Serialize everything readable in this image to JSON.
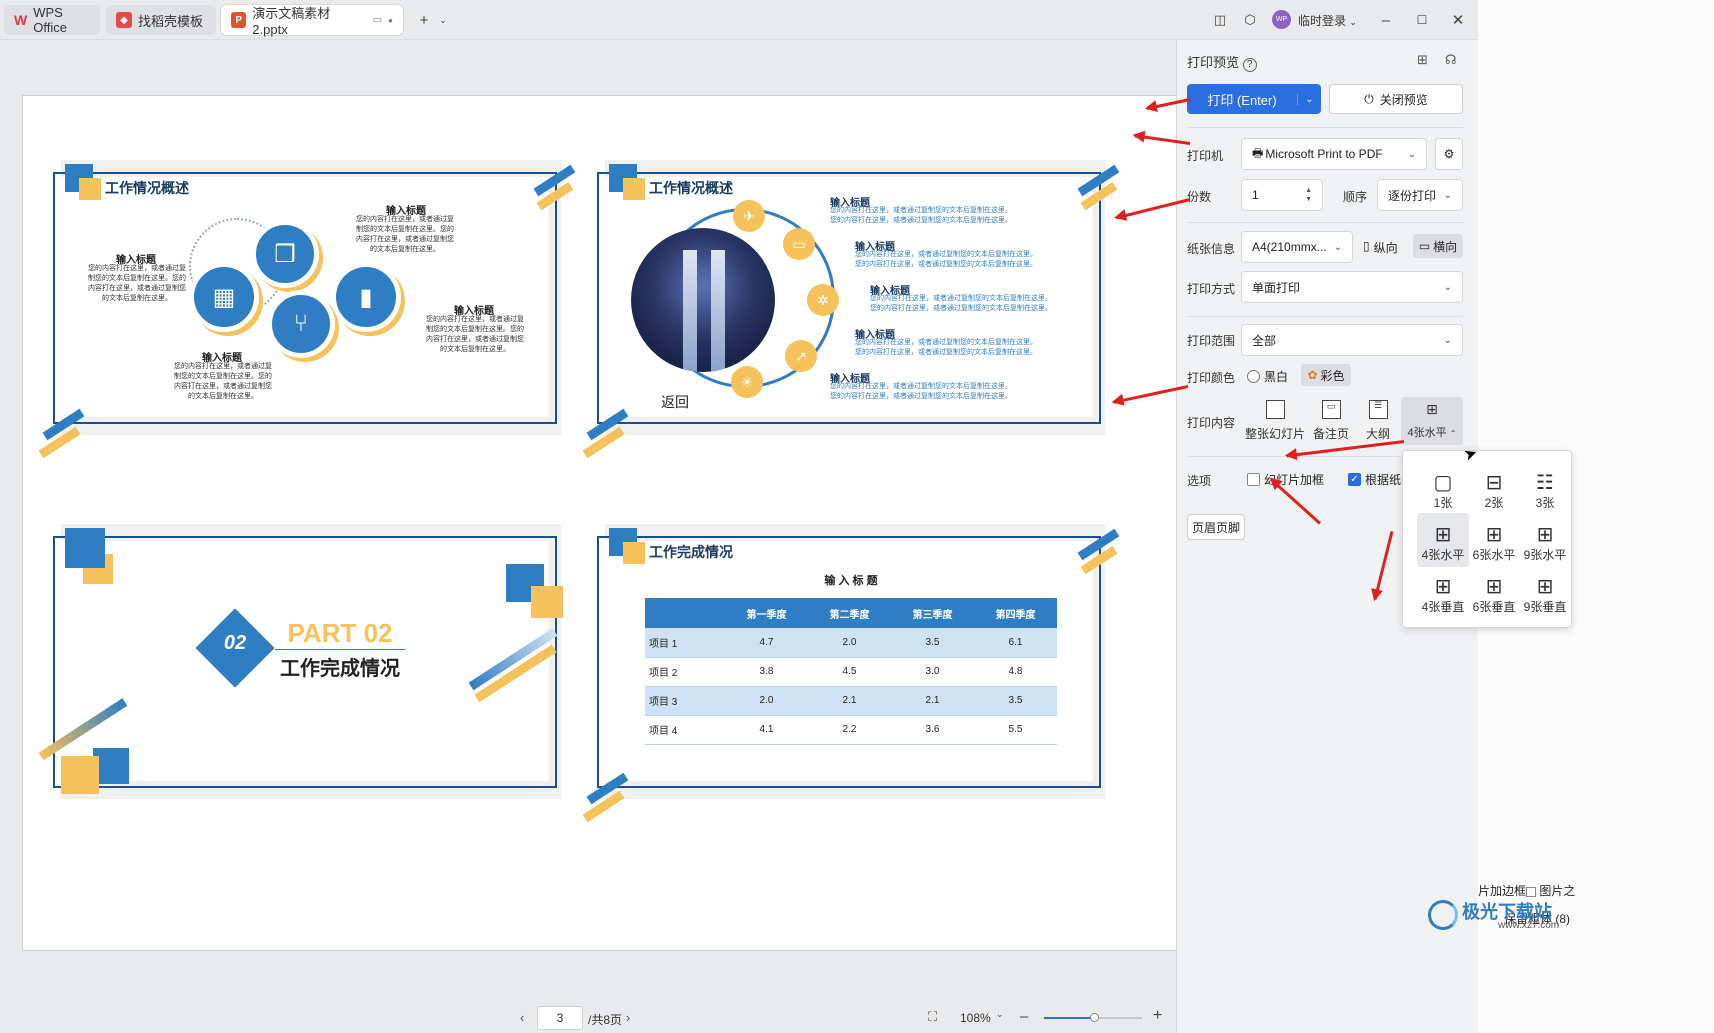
{
  "tabs": [
    {
      "label": "WPS Office",
      "icon": "wps-logo-icon"
    },
    {
      "label": "找稻壳模板",
      "icon": "docer-icon"
    },
    {
      "label": "演示文稿素材2.pptx",
      "icon": "presentation-file-icon"
    }
  ],
  "titlebar": {
    "user": "临时登录",
    "avatar": "WP"
  },
  "slides": {
    "s1": {
      "title": "工作情况概述",
      "head": "输入标题",
      "text": "您的内容打在这里，或者通过复制您的文本后复制在这里。您的内容打在这里，或者通过复制您的文本后复制在这里。"
    },
    "s2": {
      "title": "工作情况概述",
      "head": "输入标题",
      "text1": "您的内容打在这里，或者通过复制您的文本后复制在这里。",
      "text2": "您的内容打在这里，或者通过复制您的文本后复制在这里。",
      "back": "返回"
    },
    "s3": {
      "number": "02",
      "part": "PART 02",
      "subtitle": "工作完成情况"
    },
    "s4": {
      "title": "工作完成情况",
      "table_title": "输 入 标 题",
      "columns": [
        "",
        "第一季度",
        "第二季度",
        "第三季度",
        "第四季度"
      ],
      "rows": [
        [
          "项目 1",
          "4.7",
          "2.0",
          "3.5",
          "6.1"
        ],
        [
          "项目 2",
          "3.8",
          "4.5",
          "3.0",
          "4.8"
        ],
        [
          "项目 3",
          "2.0",
          "2.1",
          "2.1",
          "3.5"
        ],
        [
          "项目 4",
          "4.1",
          "2.2",
          "3.6",
          "5.5"
        ]
      ]
    }
  },
  "bottom": {
    "page": "3",
    "total": "/共8页",
    "zoom": "108%"
  },
  "panel": {
    "title": "打印预览",
    "print_button": "打印 (Enter)",
    "close_button": "关闭预览",
    "printer_label": "打印机",
    "printer_value": "Microsoft Print to PDF",
    "copies_label": "份数",
    "copies_value": "1",
    "order_label": "顺序",
    "order_value": "逐份打印",
    "paper_label": "纸张信息",
    "paper_value": "A4(210mmx...",
    "portrait": "纵向",
    "landscape": "横向",
    "mode_label": "打印方式",
    "mode_value": "单面打印",
    "range_label": "打印范围",
    "range_value": "全部",
    "color_label": "打印颜色",
    "color_bw": "黑白",
    "color_color": "彩色",
    "content_label": "打印内容",
    "content_options": [
      "整张幻灯片",
      "备注页",
      "大纲",
      "4张水平"
    ],
    "options_label": "选项",
    "opt_frame": "幻灯片加框",
    "opt_fit": "根据纸",
    "header_footer": "页眉页脚"
  },
  "layout_popup": [
    "1张",
    "2张",
    "3张",
    "4张水平",
    "6张水平",
    "9张水平",
    "4张垂直",
    "6张垂直",
    "9张垂直"
  ],
  "edge_text": {
    "e1": "片加边框",
    "e2": "图片之",
    "e3": "保留粗体 (8)"
  },
  "watermark": {
    "name": "极光下载站",
    "url": "www.xz7.com"
  },
  "colors": {
    "accent_blue": "#2b6ee0",
    "slide_blue": "#2f7dc3",
    "slide_yellow": "#f6c25b",
    "annotation_red": "#e02020"
  }
}
